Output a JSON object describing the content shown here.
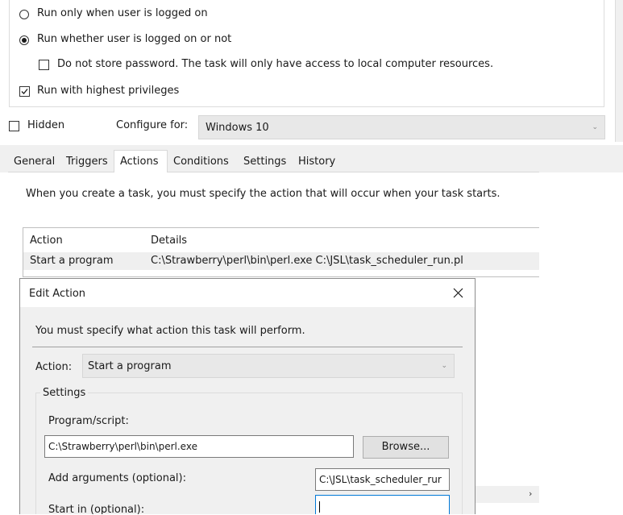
{
  "general": {
    "run_logged_on": "Run only when user is logged on",
    "run_whether": "Run whether user is logged on or not",
    "do_not_store": "Do not store password.  The task will only have access to local computer resources.",
    "highest_privileges": "Run with highest privileges",
    "hidden": "Hidden",
    "configure_for_label": "Configure for:",
    "configure_for_value": "Windows 10"
  },
  "tabs": [
    "General",
    "Triggers",
    "Actions",
    "Conditions",
    "Settings",
    "History"
  ],
  "actions_tab": {
    "description": "When you create a task, you must specify the action that will occur when your task starts.",
    "columns": [
      "Action",
      "Details"
    ],
    "rows": [
      {
        "action": "Start a program",
        "details": "C:\\Strawberry\\perl\\bin\\perl.exe C:\\JSL\\task_scheduler_run.pl"
      }
    ]
  },
  "dialog": {
    "title": "Edit Action",
    "instruction": "You must specify what action this task will perform.",
    "action_label": "Action:",
    "action_value": "Start a program",
    "settings_label": "Settings",
    "program_label": "Program/script:",
    "program_value": "C:\\Strawberry\\perl\\bin\\perl.exe",
    "browse_label": "Browse...",
    "arguments_label": "Add arguments (optional):",
    "arguments_value": "C:\\JSL\\task_scheduler_rur",
    "start_in_label": "Start in (optional):",
    "start_in_value": ""
  },
  "colors": {
    "tab_strip": "#f0f0f0",
    "row_highlight": "#efefef",
    "select_bg": "#e8e8e8",
    "button_bg": "#e1e1e1",
    "focus_border": "#0078d7"
  },
  "icons": [
    "radio-unselected-icon",
    "radio-selected-icon",
    "checkbox-unchecked-icon",
    "checkbox-checked-icon",
    "chevron-down-icon",
    "close-icon",
    "scroll-right-icon"
  ]
}
